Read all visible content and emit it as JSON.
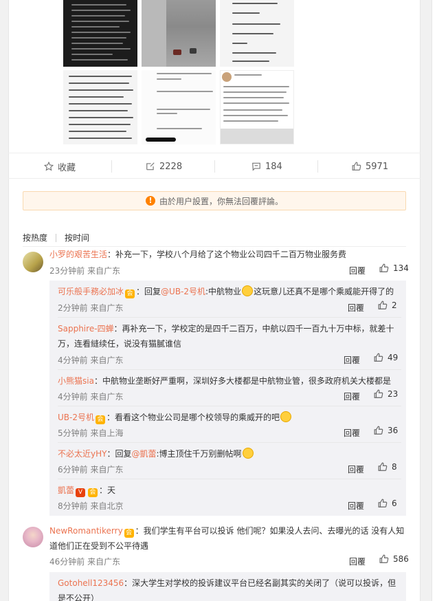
{
  "actions": {
    "favorite": "收藏",
    "repost": "2228",
    "comment": "184",
    "like": "5971"
  },
  "notice": "由於用户設置，你無法回覆評論。",
  "sort": {
    "hot": "按热度",
    "time": "按时间"
  },
  "labels": {
    "reply": "回覆"
  },
  "comments": [
    {
      "user": "小罗的艰苦生活",
      "text": "：补充一下，学校八个月给了这个物业公司四千二百万物业服务费",
      "time": "23分钟前 来自广东",
      "likes": "134"
    },
    {
      "user": "NewRomantikerry",
      "text": "：我们学生有平台可以投诉 他们呢？如果没人去问、去曝光的话 没有人知道他们正在受到不公平待遇",
      "time": "46分钟前 来自广东",
      "likes": "586"
    }
  ],
  "replies": [
    {
      "user": "可乐般手務必加冰",
      "prefix": "：回复",
      "mention": "@UB-2号机",
      "text1": ":中航物业",
      "text2": "这玩意儿还真不是哪个乘威能开得了的",
      "time": "2分钟前 来自广东",
      "likes": "2"
    },
    {
      "user": "Sapphire-四蝉",
      "text": "：再补充一下，学校定的是四千二百万，中航以四千一百九十万中标，就差十万，连看縫续任，说没有猫膩谁信",
      "time": "4分钟前 来自广东",
      "likes": "49"
    },
    {
      "user": "小熊猫sia",
      "text": "：中航物业垄断好严重啊，深圳好多大楼都是中航物业管，很多政府机关大楼都是",
      "time": "4分钟前 来自广东",
      "likes": "23"
    },
    {
      "user": "UB-2号机",
      "text": "：看看这个物业公司是哪个校领导的乘威开的吧",
      "time": "5分钟前 来自上海",
      "likes": "36"
    },
    {
      "user": "不必太近yHY",
      "prefix": "：回复",
      "mention": "@凱蕾",
      "text": ":博主顶住千万别删帖啊",
      "time": "6分钟前 来自广东",
      "likes": "8"
    },
    {
      "user": "凱蕾",
      "text": "：天",
      "time": "8分钟前 来自北京",
      "likes": "6"
    },
    {
      "user": "Gotohell123456",
      "text": "：深大学生对学校的投诉建议平台已经名副其实的关闭了（说可以投诉，但是不公开）"
    }
  ],
  "colors": {
    "username": "#eb7350",
    "accent": "#ff8200",
    "subBox": "#f2f2f5"
  }
}
